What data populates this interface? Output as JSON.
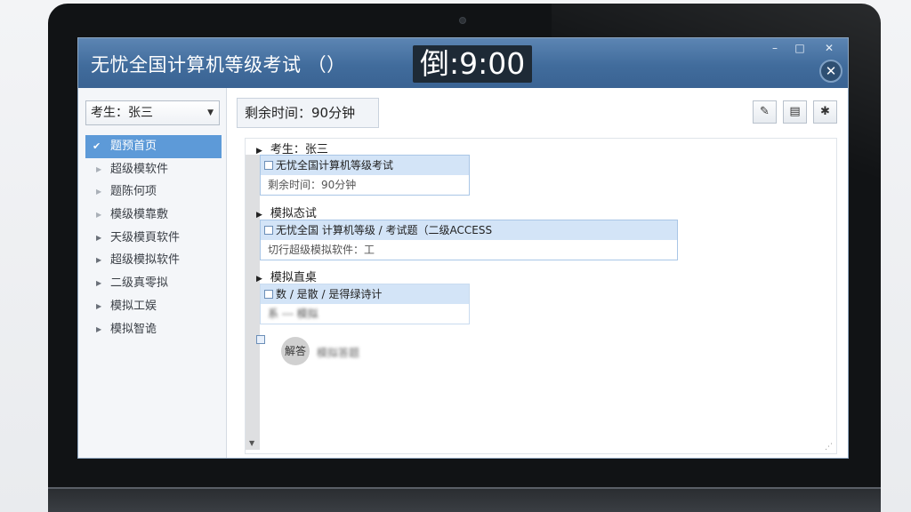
{
  "window": {
    "title": "无忧全国计算机等级考试 （）",
    "countdown": "倒:9:00",
    "controls": {
      "minimize": "–",
      "maximize": "□",
      "close": "✕"
    }
  },
  "sidebar": {
    "candidate": "考生：张三",
    "items": [
      {
        "label": "题预首页",
        "active": true
      },
      {
        "label": "超级模软件"
      },
      {
        "label": "题陈何项"
      },
      {
        "label": "模级模靠敷"
      },
      {
        "label": "天级模頁软件"
      },
      {
        "label": "超级模拟软件"
      },
      {
        "label": "二级真零拟"
      },
      {
        "label": "模拟工娱"
      },
      {
        "label": "模拟智诡"
      }
    ]
  },
  "main": {
    "timer": "剩余时间：90分钟",
    "sections": [
      {
        "head": "考生：张三",
        "lines": [
          "无忧全国计算机等级考试",
          "剩余时间：90分钟"
        ]
      },
      {
        "head": "模拟态试",
        "lines": [
          "无忧全国 计算机等级 / 考试题（二级ACCESS",
          "切行超级模拟软件：工"
        ]
      },
      {
        "head": "模拟直桌",
        "lines": [
          "数 / 是散 / 是得绿诗计",
          "系 --- 模拟"
        ]
      }
    ],
    "answer_label": "解答",
    "answer_hint": "模拟答题"
  }
}
